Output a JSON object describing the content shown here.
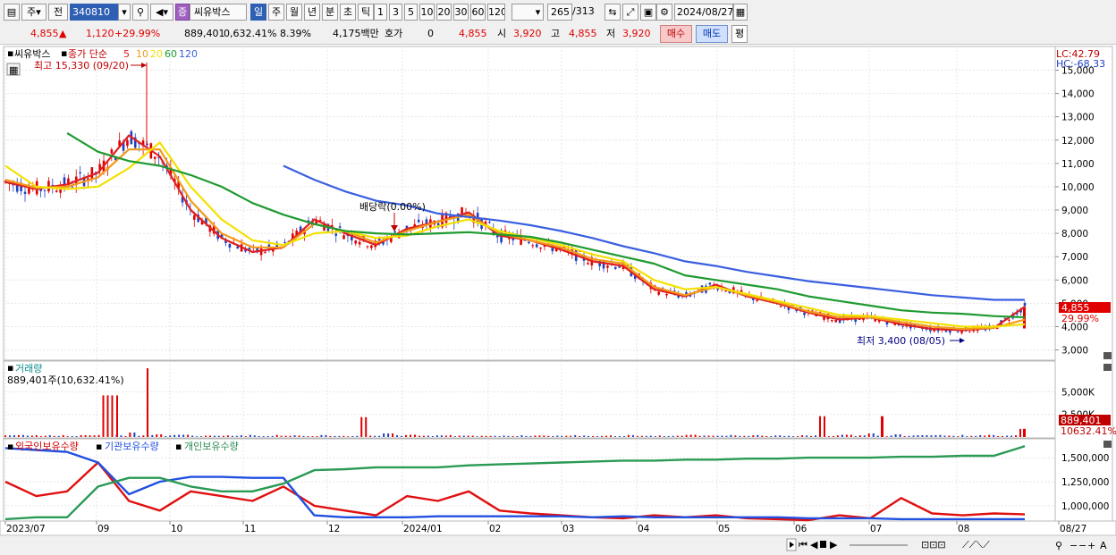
{
  "toolbar": {
    "type_select": "주",
    "prev_label": "전",
    "code_value": "340810",
    "stock_badge": "증",
    "stock_name": "씨유박스",
    "periods": [
      "일",
      "주",
      "월",
      "년",
      "분",
      "초",
      "틱"
    ],
    "intervals": [
      "1",
      "3",
      "5",
      "10",
      "20",
      "30",
      "60",
      "120"
    ],
    "count_value": "265",
    "count_total": "/313",
    "date_value": "2024/08/27"
  },
  "quote": {
    "price": "4,855",
    "change": "1,120",
    "change_pct": "+29.99%",
    "volume": "889,401",
    "volume_pct": "0,632.41%",
    "turnover": "8.39%",
    "amount": "4,175백만",
    "bid_label": "호가",
    "bid_value": "0",
    "bid_price": "4,855",
    "open_label": "시",
    "open_value": "3,920",
    "high_label": "고",
    "high_value": "4,855",
    "low_label": "저",
    "low_value": "3,920",
    "buy_button": "매수",
    "sell_button": "매도",
    "avg_button": "평"
  },
  "price_panel": {
    "stock_name": "씨유박스",
    "ma_label": "종가 단순",
    "ma_periods": [
      "5",
      "10",
      "20",
      "60",
      "120"
    ],
    "high_note": "최고 15,330 (09/20)",
    "low_note": "최저 3,400 (08/05)",
    "dividend_note": "배당락(0.00%)",
    "lc_label": "LC:42.79",
    "hc_label": "HC:-68.33",
    "price_tag": "4,855",
    "pct_tag": "29.99%"
  },
  "volume_panel": {
    "title": "거래량",
    "value": "889,401주(10,632.41%)",
    "tag_value": "889,401",
    "tag_pct": "10632.41%"
  },
  "holdings_panel": {
    "foreign": "외국인보유수량",
    "institution": "기관보유수량",
    "individual": "개인보유수량"
  },
  "x_axis": {
    "ticks": [
      "2023/07",
      "09",
      "10",
      "11",
      "12",
      "2024/01",
      "02",
      "03",
      "04",
      "05",
      "06",
      "07",
      "08",
      "08/27"
    ]
  },
  "colors": {
    "ma5": "#e02020",
    "ma10": "#f39a1a",
    "ma20": "#f2e100",
    "ma60": "#1f9a30",
    "ma120": "#3a5fe0",
    "up": "#e00000",
    "down": "#2040c0",
    "foreign_line": "#e01010",
    "institution_line": "#2050e0",
    "individual_line": "#2a9a55"
  },
  "chart_data": [
    {
      "type": "line",
      "title": "씨유박스",
      "y_ticks": [
        "3,000",
        "4,000",
        "5,000",
        "6,000",
        "7,000",
        "8,000",
        "9,000",
        "10,000",
        "11,000",
        "12,000",
        "13,000",
        "14,000",
        "15,000"
      ],
      "ylim": [
        2600,
        15900
      ],
      "x_months": [
        "2023/07",
        "09",
        "10",
        "11",
        "12",
        "2024/01",
        "02",
        "03",
        "04",
        "05",
        "06",
        "07",
        "08"
      ],
      "series": [
        {
          "name": "5",
          "values": [
            10200,
            9900,
            10100,
            10600,
            12200,
            11300,
            9000,
            7800,
            7200,
            7400,
            8600,
            8000,
            7500,
            8200,
            8500,
            8900,
            7900,
            7700,
            7300,
            6800,
            6600,
            5600,
            5300,
            5800,
            5300,
            5000,
            4600,
            4300,
            4400,
            4100,
            3900,
            3850,
            3950,
            4855
          ]
        },
        {
          "name": "10",
          "values": [
            10300,
            9950,
            10000,
            10400,
            11600,
            11600,
            9400,
            8000,
            7400,
            7400,
            8400,
            8100,
            7600,
            8100,
            8500,
            8800,
            8000,
            7700,
            7400,
            6900,
            6700,
            5700,
            5350,
            5700,
            5350,
            5050,
            4650,
            4400,
            4400,
            4200,
            4000,
            3900,
            3950,
            4300
          ]
        },
        {
          "name": "20",
          "values": [
            10900,
            10000,
            9900,
            10000,
            10800,
            11900,
            10000,
            8600,
            7700,
            7500,
            8000,
            8100,
            7800,
            7900,
            8300,
            8600,
            8100,
            7800,
            7500,
            7100,
            6800,
            6000,
            5600,
            5700,
            5400,
            5100,
            4800,
            4500,
            4450,
            4300,
            4150,
            4000,
            4000,
            4100
          ]
        },
        {
          "name": "60",
          "values": [
            null,
            null,
            12300,
            11500,
            11100,
            10900,
            10500,
            10000,
            9300,
            8800,
            8400,
            8100,
            8000,
            7950,
            8000,
            8050,
            7950,
            7850,
            7600,
            7300,
            7000,
            6700,
            6200,
            6000,
            5800,
            5600,
            5300,
            5100,
            4900,
            4700,
            4600,
            4550,
            4450,
            4400
          ]
        },
        {
          "name": "120",
          "values": [
            null,
            null,
            null,
            null,
            null,
            null,
            null,
            null,
            null,
            10900,
            10300,
            9800,
            9400,
            9200,
            8850,
            8700,
            8550,
            8350,
            8100,
            7800,
            7450,
            7150,
            6800,
            6600,
            6350,
            6150,
            5950,
            5800,
            5650,
            5500,
            5350,
            5250,
            5150,
            5150
          ]
        }
      ]
    },
    {
      "type": "bar",
      "title": "거래량",
      "y_ticks": [
        "2,500K",
        "5,000K"
      ],
      "ylim": [
        0,
        8000
      ],
      "series": [
        {
          "name": "거래량",
          "values": [
            180,
            150,
            120,
            200,
            4600,
            500,
            300,
            250,
            150,
            120,
            100,
            130,
            90,
            110,
            2200,
            400,
            250,
            180,
            150,
            120,
            100,
            160,
            130,
            110,
            90,
            120,
            100,
            250,
            140,
            120,
            100,
            90,
            2300,
            250,
            400,
            300,
            200,
            150,
            120,
            100,
            900
          ]
        }
      ]
    },
    {
      "type": "line",
      "title": "외국인보유수량",
      "y_ticks": [
        "1,000,000",
        "1,250,000",
        "1,500,000"
      ],
      "ylim": [
        850000,
        1650000
      ],
      "series": [
        {
          "name": "외국인보유수량",
          "values": [
            1250000,
            1100000,
            1150000,
            1450000,
            1050000,
            950000,
            1150000,
            1100000,
            1050000,
            1200000,
            1000000,
            950000,
            900000,
            1100000,
            1050000,
            1150000,
            950000,
            920000,
            900000,
            880000,
            870000,
            900000,
            880000,
            900000,
            870000,
            860000,
            850000,
            900000,
            870000,
            1080000,
            920000,
            900000,
            920000,
            910000
          ]
        },
        {
          "name": "기관보유수량",
          "values": [
            1600000,
            1580000,
            1560000,
            1450000,
            1120000,
            1250000,
            1300000,
            1300000,
            1290000,
            1290000,
            900000,
            880000,
            880000,
            880000,
            890000,
            890000,
            890000,
            890000,
            890000,
            880000,
            890000,
            880000,
            880000,
            880000,
            880000,
            880000,
            870000,
            870000,
            870000,
            860000,
            860000,
            860000,
            860000,
            860000
          ]
        },
        {
          "name": "개인보유수량",
          "values": [
            860000,
            880000,
            880000,
            1200000,
            1290000,
            1290000,
            1200000,
            1150000,
            1150000,
            1230000,
            1370000,
            1380000,
            1400000,
            1400000,
            1400000,
            1420000,
            1430000,
            1440000,
            1450000,
            1460000,
            1470000,
            1470000,
            1480000,
            1480000,
            1490000,
            1490000,
            1500000,
            1500000,
            1500000,
            1510000,
            1510000,
            1520000,
            1520000,
            1620000
          ]
        }
      ]
    }
  ]
}
